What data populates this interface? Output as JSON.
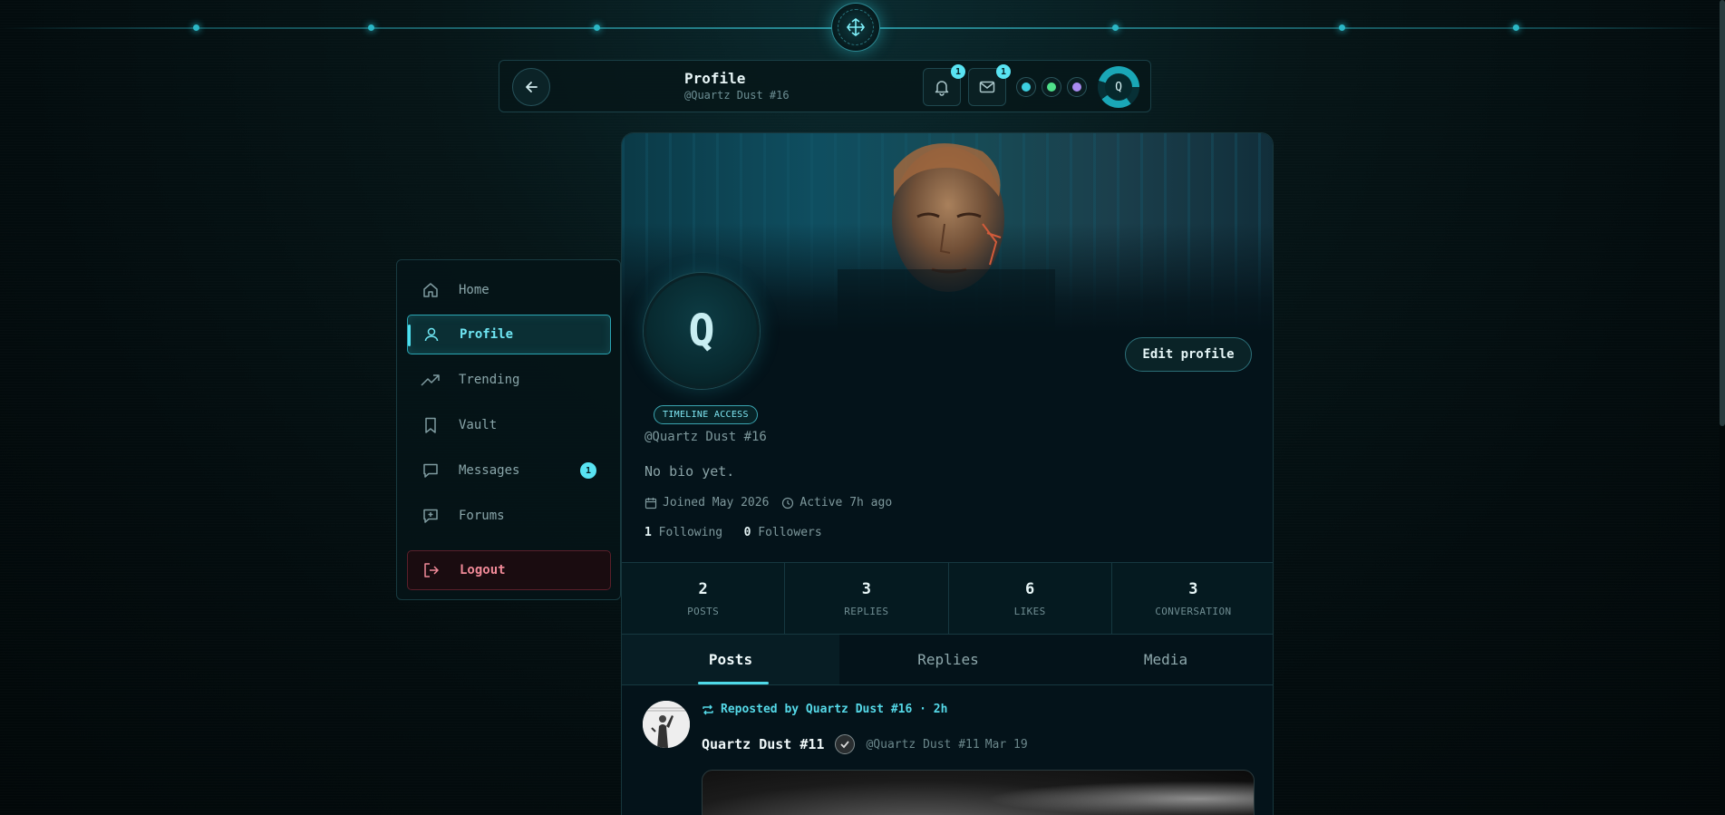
{
  "header": {
    "title": "Profile",
    "subtitle": "@Quartz Dust #16",
    "notifications_count": "1",
    "messages_count": "1",
    "avatar_initial": "Q",
    "status_colors": [
      "#3ccfe0",
      "#4fe08a",
      "#a98bf0"
    ]
  },
  "sidebar": {
    "items": [
      {
        "label": "Home",
        "icon": "home-icon"
      },
      {
        "label": "Profile",
        "icon": "user-icon"
      },
      {
        "label": "Trending",
        "icon": "trending-icon"
      },
      {
        "label": "Vault",
        "icon": "bookmark-icon"
      },
      {
        "label": "Messages",
        "icon": "message-icon",
        "badge": "1"
      },
      {
        "label": "Forums",
        "icon": "forum-icon"
      }
    ],
    "logout_label": "Logout"
  },
  "profile": {
    "avatar_initial": "Q",
    "edit_label": "Edit profile",
    "access_badge": "TIMELINE ACCESS",
    "handle": "@Quartz Dust #16",
    "bio": "No bio yet.",
    "joined": "Joined May 2026",
    "active": "Active 7h ago",
    "following_count": "1",
    "following_label": "Following",
    "followers_count": "0",
    "followers_label": "Followers"
  },
  "stats": [
    {
      "value": "2",
      "label": "POSTS"
    },
    {
      "value": "3",
      "label": "REPLIES"
    },
    {
      "value": "6",
      "label": "LIKES"
    },
    {
      "value": "3",
      "label": "CONVERSATION"
    }
  ],
  "tabs": [
    "Posts",
    "Replies",
    "Media"
  ],
  "post": {
    "repost_text": "Reposted by Quartz Dust #16 · 2h",
    "author": "Quartz Dust #11",
    "handle": "@Quartz Dust #11",
    "date": "Mar 19"
  },
  "colors": {
    "accent": "#4fe0ef",
    "background": "#04131a",
    "logout": "#f08a98"
  }
}
